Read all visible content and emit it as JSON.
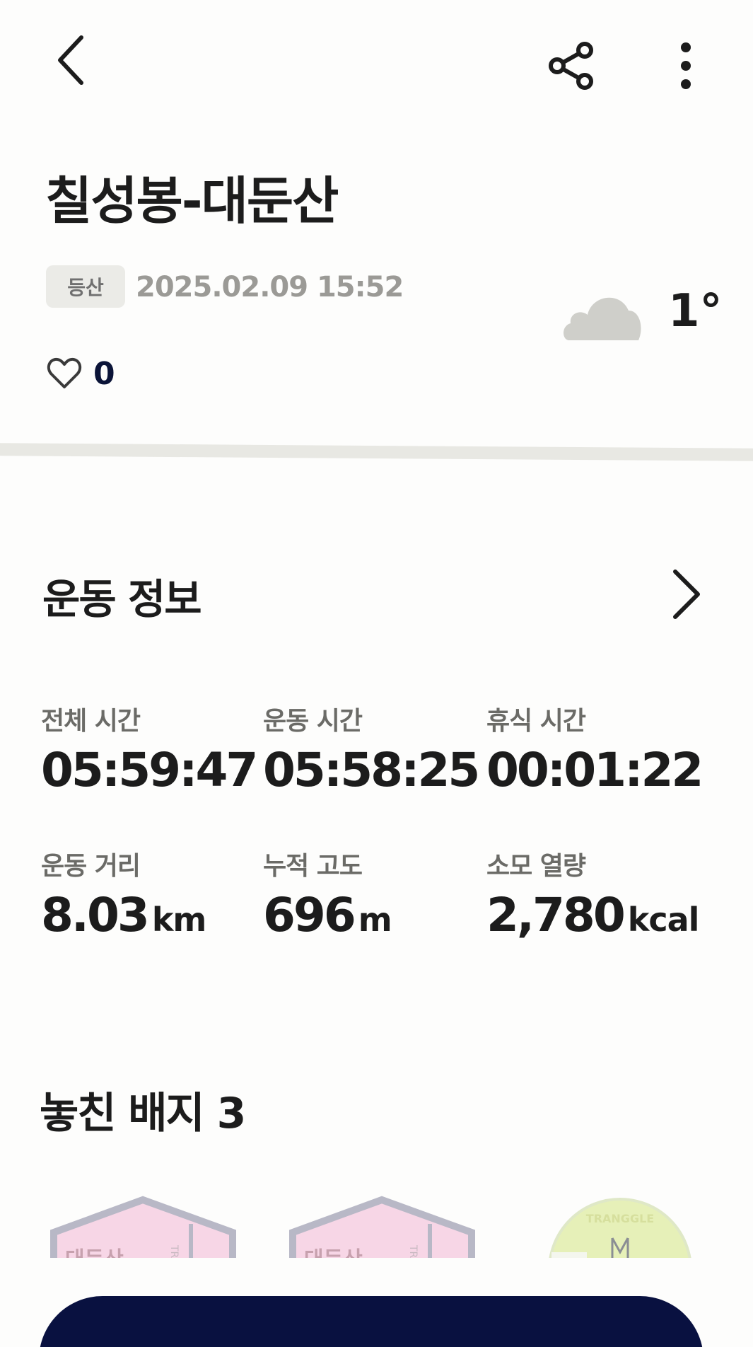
{
  "header": {
    "title": "칠성봉-대둔산",
    "category": "등산",
    "datetime": "2025.02.09 15:52",
    "temperature": "1°",
    "weather_icon": "cloud-icon",
    "like_count": "0"
  },
  "exercise": {
    "section_title": "운동 정보",
    "stats": [
      {
        "label": "전체 시간",
        "value": "05:59:47",
        "unit": ""
      },
      {
        "label": "운동 시간",
        "value": "05:58:25",
        "unit": ""
      },
      {
        "label": "휴식 시간",
        "value": "00:01:22",
        "unit": ""
      },
      {
        "label": "운동 거리",
        "value": "8.03",
        "unit": "km"
      },
      {
        "label": "누적 고도",
        "value": "696",
        "unit": "m"
      },
      {
        "label": "소모 열량",
        "value": "2,780",
        "unit": "kcal"
      }
    ]
  },
  "badges": {
    "title": "놓친 배지 3",
    "items": [
      {
        "label": "대둔산",
        "side": "TRA"
      },
      {
        "label": "대둔산",
        "side": "TRA"
      },
      {
        "label": "TRANGGLE"
      }
    ]
  },
  "colors": {
    "accent_navy": "#091140",
    "divider": "#e8e8e3",
    "badge_pink": "#f7d6e6",
    "badge_frame": "#b8b8c6",
    "badge_green": "#e6f0b8"
  }
}
